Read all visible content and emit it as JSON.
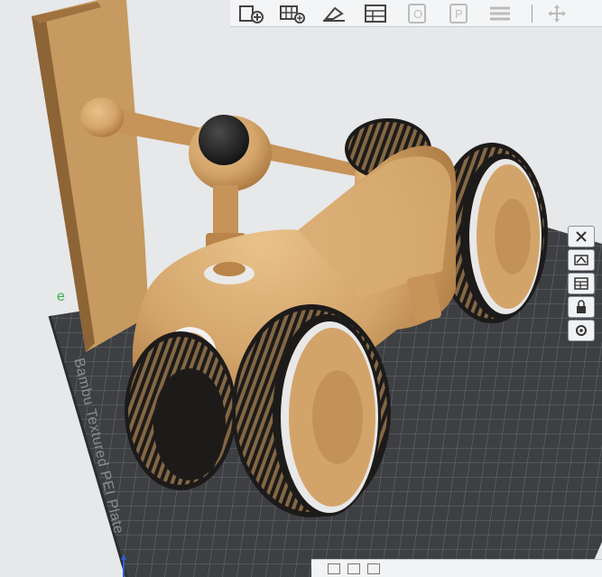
{
  "toolbar": {
    "buttons": [
      {
        "icon": "add-part-icon",
        "enabled": true
      },
      {
        "icon": "add-plate-icon",
        "enabled": true
      },
      {
        "icon": "auto-orient-icon",
        "enabled": true
      },
      {
        "icon": "arrange-icon",
        "enabled": true
      },
      {
        "icon": "split-objects-icon",
        "enabled": false
      },
      {
        "icon": "split-parts-icon",
        "enabled": false
      },
      {
        "icon": "layers-icon",
        "enabled": false
      },
      {
        "icon": "move-gizmo-icon",
        "enabled": false
      }
    ]
  },
  "plate": {
    "label": "Bambu Textured PEI Plate"
  },
  "side_tools": [
    "close-plate-icon",
    "orient-plate-icon",
    "arrange-plate-icon",
    "lock-plate-icon",
    "settings-plate-icon"
  ],
  "colors": {
    "model_body": "#d3a46a",
    "model_shadow": "#a9773e",
    "tire": "#1d1b1a",
    "tread": "#c89a5f",
    "rim_ring": "#e8e8e8",
    "build_plate": "#3d3f42",
    "grid_line": "#6a6d71",
    "wipe_tower": "#c69a61",
    "background": "#e6e8ea"
  }
}
